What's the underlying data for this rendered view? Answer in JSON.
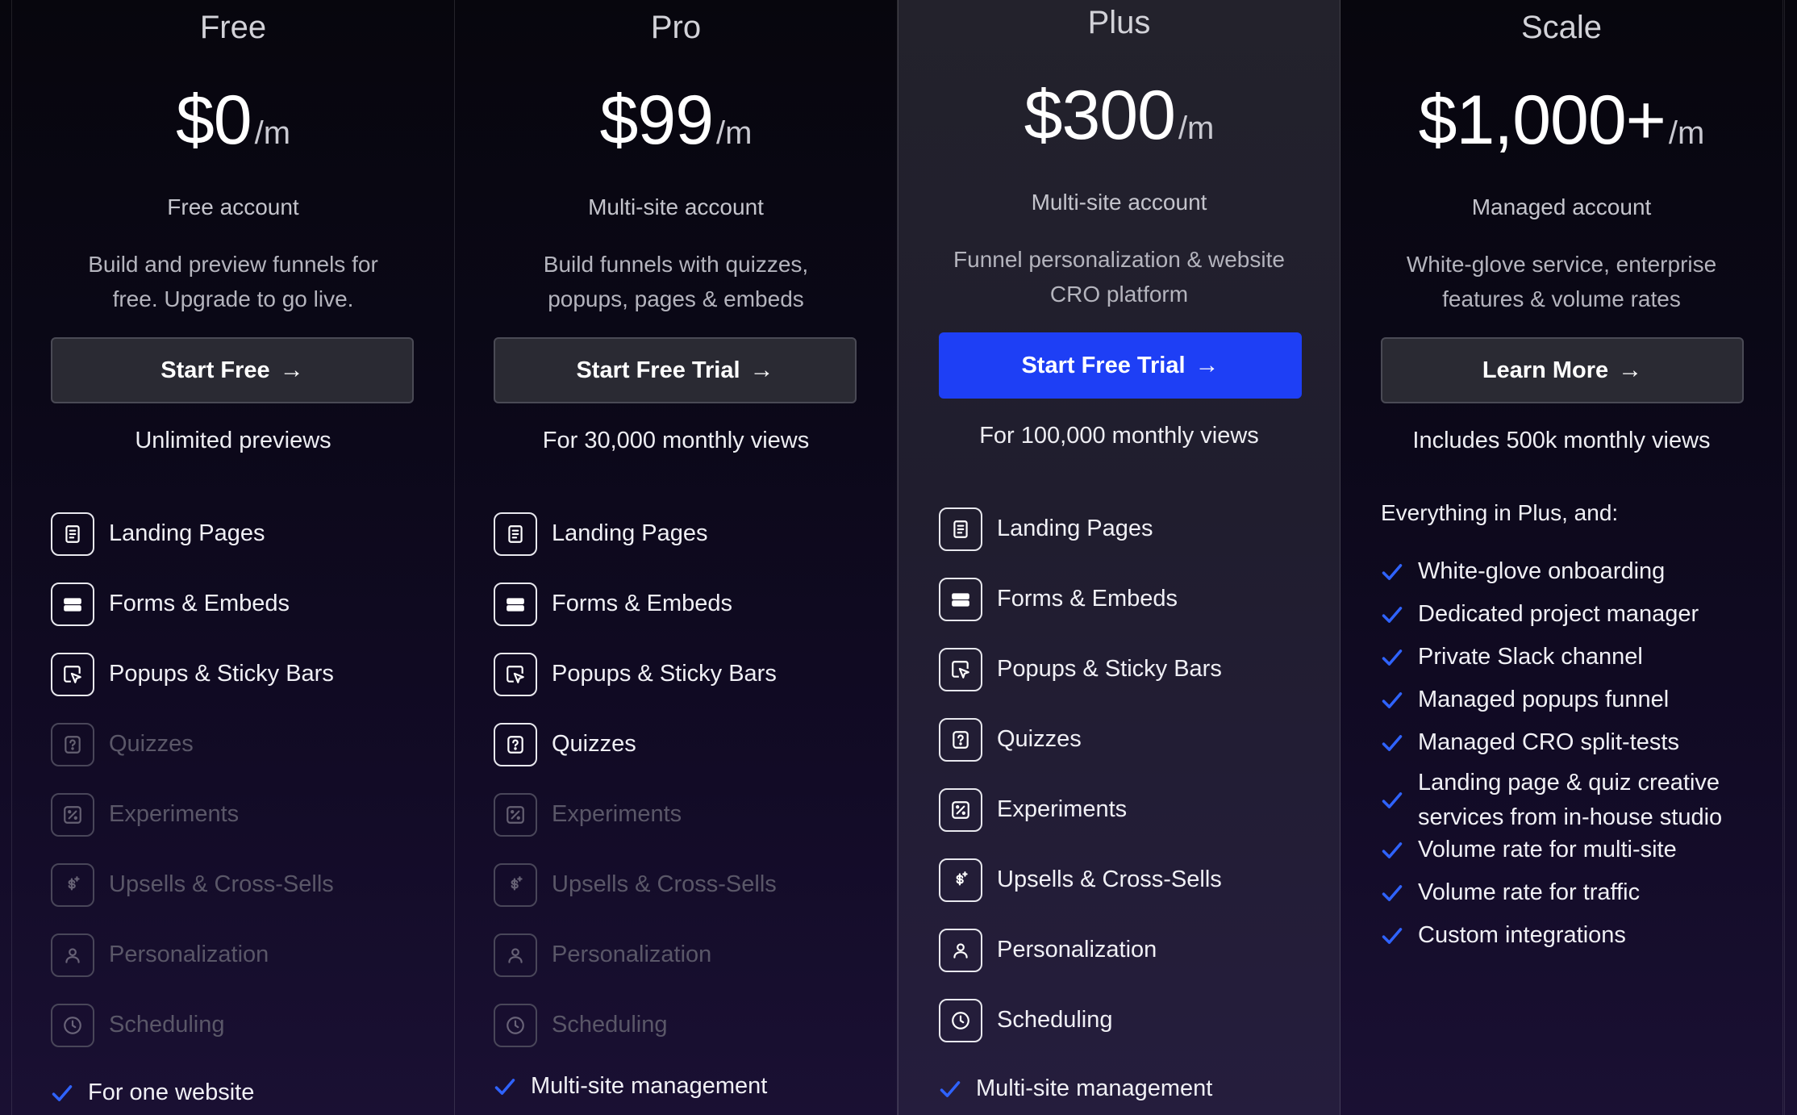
{
  "accent_color": "#1e3ff5",
  "plans": [
    {
      "name": "Free",
      "price": "$0",
      "period": "/m",
      "account": "Free account",
      "description_line1": "Build and preview funnels for",
      "description_line2": "free. Upgrade to go live.",
      "cta_label": "Start Free",
      "views": "Unlimited previews",
      "features": [
        {
          "label": "Landing Pages",
          "icon": "document-icon",
          "enabled": true
        },
        {
          "label": "Forms & Embeds",
          "icon": "form-icon",
          "enabled": true
        },
        {
          "label": "Popups & Sticky Bars",
          "icon": "popup-cursor-icon",
          "enabled": true
        },
        {
          "label": "Quizzes",
          "icon": "question-icon",
          "enabled": false
        },
        {
          "label": "Experiments",
          "icon": "experiment-icon",
          "enabled": false
        },
        {
          "label": "Upsells & Cross-Sells",
          "icon": "dollar-icon",
          "enabled": false
        },
        {
          "label": "Personalization",
          "icon": "user-icon",
          "enabled": false
        },
        {
          "label": "Scheduling",
          "icon": "clock-icon",
          "enabled": false
        }
      ],
      "bottom": "For one website"
    },
    {
      "name": "Pro",
      "price": "$99",
      "period": "/m",
      "account": "Multi-site account",
      "description_line1": "Build funnels with quizzes,",
      "description_line2": "popups, pages & embeds",
      "cta_label": "Start Free Trial",
      "views": "For 30,000 monthly views",
      "features": [
        {
          "label": "Landing Pages",
          "icon": "document-icon",
          "enabled": true
        },
        {
          "label": "Forms & Embeds",
          "icon": "form-icon",
          "enabled": true
        },
        {
          "label": "Popups & Sticky Bars",
          "icon": "popup-cursor-icon",
          "enabled": true
        },
        {
          "label": "Quizzes",
          "icon": "question-icon",
          "enabled": true
        },
        {
          "label": "Experiments",
          "icon": "experiment-icon",
          "enabled": false
        },
        {
          "label": "Upsells & Cross-Sells",
          "icon": "dollar-icon",
          "enabled": false
        },
        {
          "label": "Personalization",
          "icon": "user-icon",
          "enabled": false
        },
        {
          "label": "Scheduling",
          "icon": "clock-icon",
          "enabled": false
        }
      ],
      "bottom": "Multi-site management"
    },
    {
      "name": "Plus",
      "price": "$300",
      "period": "/m",
      "account": "Multi-site account",
      "description_line1": "Funnel personalization & website",
      "description_line2": "CRO platform",
      "cta_label": "Start Free Trial",
      "views": "For 100,000 monthly views",
      "features": [
        {
          "label": "Landing Pages",
          "icon": "document-icon",
          "enabled": true
        },
        {
          "label": "Forms & Embeds",
          "icon": "form-icon",
          "enabled": true
        },
        {
          "label": "Popups & Sticky Bars",
          "icon": "popup-cursor-icon",
          "enabled": true
        },
        {
          "label": "Quizzes",
          "icon": "question-icon",
          "enabled": true
        },
        {
          "label": "Experiments",
          "icon": "experiment-icon",
          "enabled": true
        },
        {
          "label": "Upsells & Cross-Sells",
          "icon": "dollar-icon",
          "enabled": true
        },
        {
          "label": "Personalization",
          "icon": "user-icon",
          "enabled": true
        },
        {
          "label": "Scheduling",
          "icon": "clock-icon",
          "enabled": true
        }
      ],
      "bottom": "Multi-site management"
    },
    {
      "name": "Scale",
      "price": "$1,000+",
      "period": "/m",
      "account": "Managed account",
      "description_line1": "White-glove service, enterprise",
      "description_line2": "features & volume rates",
      "cta_label": "Learn More",
      "views": "Includes 500k monthly views",
      "intro": "Everything in Plus, and:",
      "checklist": [
        {
          "line1": "White-glove onboarding"
        },
        {
          "line1": "Dedicated project manager"
        },
        {
          "line1": "Private Slack channel"
        },
        {
          "line1": "Managed popups funnel"
        },
        {
          "line1": "Managed CRO split-tests"
        },
        {
          "line1": "Landing page & quiz creative",
          "line2": "services from in-house studio"
        },
        {
          "line1": "Volume rate for multi-site"
        },
        {
          "line1": "Volume rate for traffic"
        },
        {
          "line1": "Custom integrations"
        }
      ]
    }
  ]
}
